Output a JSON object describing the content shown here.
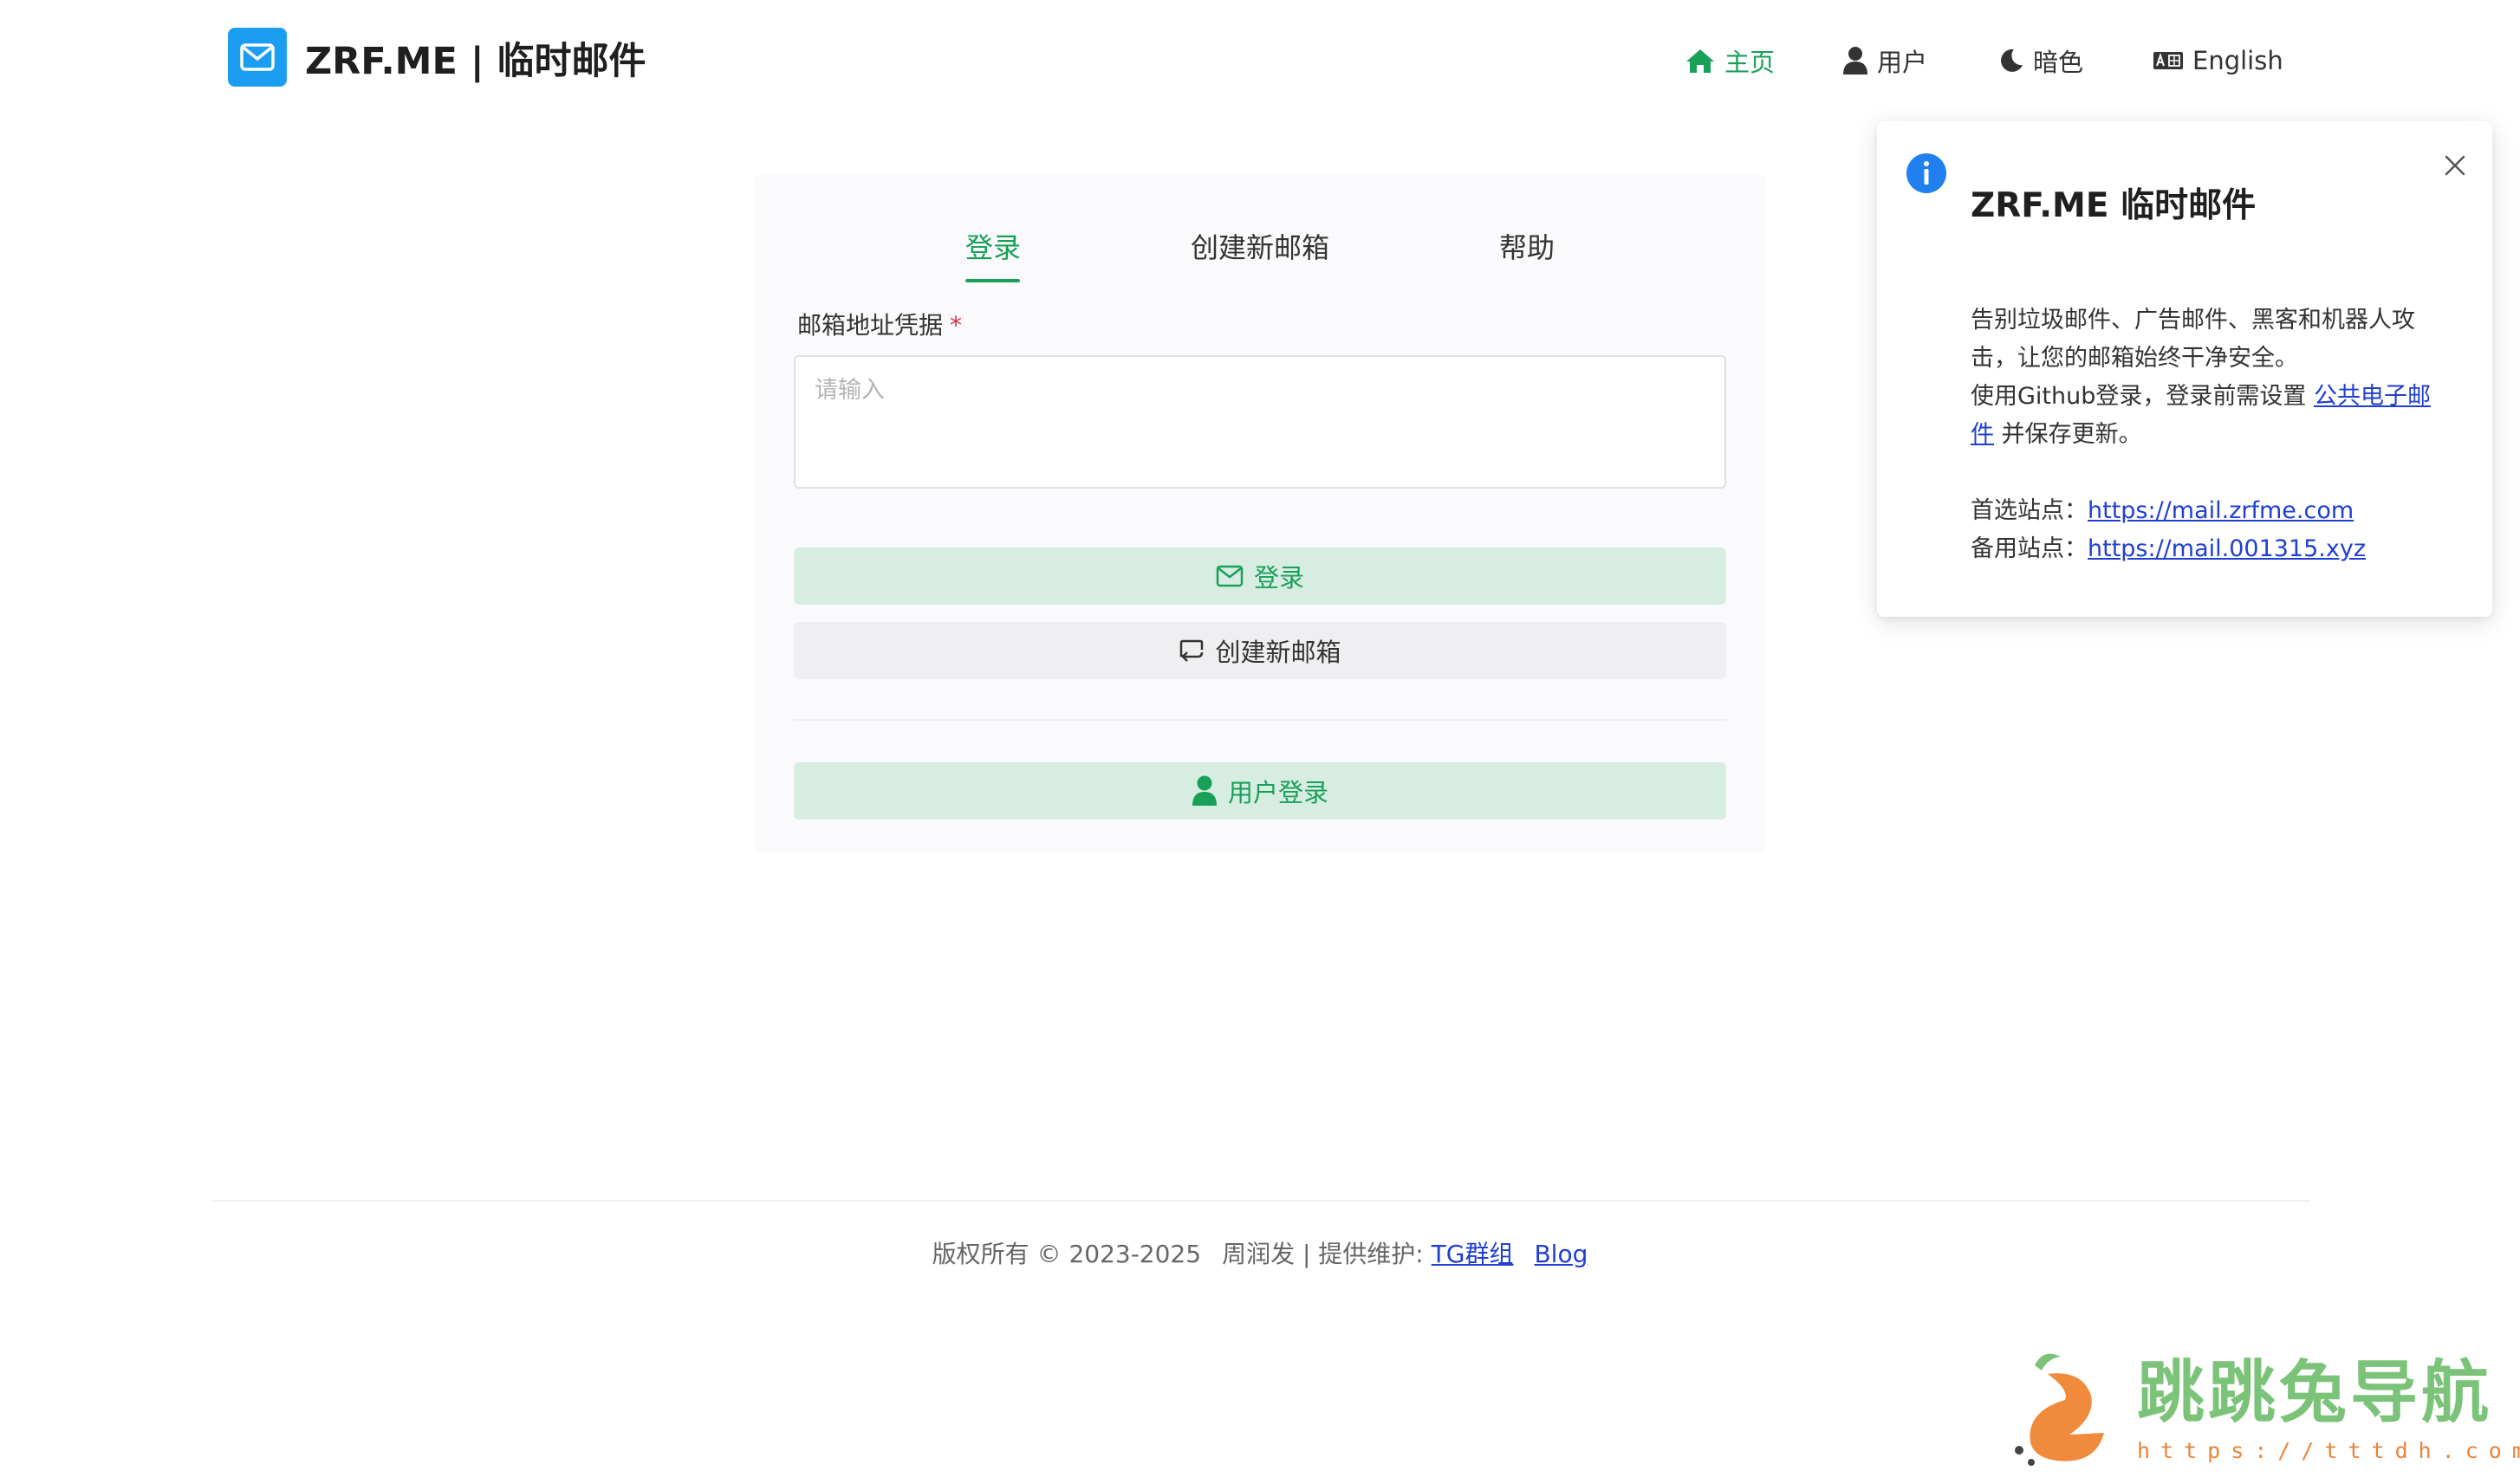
{
  "header": {
    "brand": "ZRF.ME | 临时邮件",
    "nav": {
      "home": "主页",
      "user": "用户",
      "dark": "暗色",
      "language": "English"
    }
  },
  "login_card": {
    "tabs": [
      "登录",
      "创建新邮箱",
      "帮助"
    ],
    "active_tab": "登录",
    "field_label": "邮箱地址凭据",
    "required_mark": "*",
    "credential_placeholder": "请输入",
    "credential_value": "",
    "login_button": "登录",
    "create_button": "创建新邮箱",
    "user_login_button": "用户登录"
  },
  "notification": {
    "title": "ZRF.ME 临时邮件",
    "line1": "告别垃圾邮件、广告邮件、黑客和机器人攻击，让您的邮箱始终干净安全。",
    "line2_prefix": "使用Github登录，登录前需设置 ",
    "line2_link": "公共电子邮件",
    "line2_suffix": " 并保存更新。",
    "primary_label": "首选站点：",
    "primary_url": "https://mail.zrfme.com",
    "backup_label": "备用站点：",
    "backup_url": "https://mail.001315.xyz"
  },
  "footer": {
    "copyright": "版权所有 © 2023-2025",
    "author": "周润发 | 提供维护:",
    "tg_link": "TG群组",
    "blog_link": "Blog"
  },
  "watermark": {
    "name": "跳跳兔导航",
    "url": "https://tttdh.com"
  },
  "colors": {
    "accent": "#18a058",
    "logo": "#1b9ef2",
    "info": "#2080f0",
    "link": "#1f3fd0",
    "required": "#d03050"
  }
}
